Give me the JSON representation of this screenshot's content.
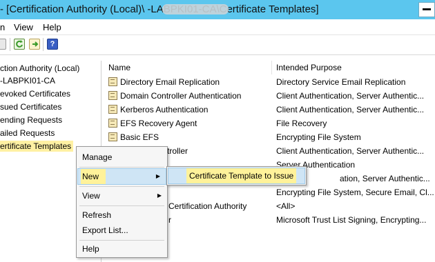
{
  "window": {
    "title": "- [Certification Authority (Local)\\                    -LABPKI01-CA\\Certificate Templates]"
  },
  "menubar": {
    "items": [
      "View",
      "Help"
    ]
  },
  "toolbar": {
    "icons": [
      "back-icon",
      "refresh-icon",
      "export-list-icon",
      "help-icon"
    ]
  },
  "tree": {
    "items": [
      {
        "label": "ction Authority (Local)"
      },
      {
        "label": "       -LABPKI01-CA"
      },
      {
        "label": "evoked Certificates"
      },
      {
        "label": "sued Certificates"
      },
      {
        "label": "ending Requests"
      },
      {
        "label": "ailed Requests"
      },
      {
        "label": "ertificate Templates"
      }
    ]
  },
  "list": {
    "columns": [
      "Name",
      "Intended Purpose"
    ],
    "rows": [
      {
        "name": "Directory Email Replication",
        "purpose": "Directory Service Email Replication"
      },
      {
        "name": "Domain Controller Authentication",
        "purpose": "Client Authentication, Server Authentic..."
      },
      {
        "name": "Kerberos Authentication",
        "purpose": "Client Authentication, Server Authentic..."
      },
      {
        "name": "EFS Recovery Agent",
        "purpose": "File Recovery"
      },
      {
        "name": "Basic EFS",
        "purpose": "Encrypting File System"
      },
      {
        "name": "troller",
        "purpose": "Client Authentication, Server Authentic..."
      },
      {
        "name": "",
        "purpose": "Server Authentication"
      },
      {
        "name": "",
        "purpose": "ation, Server Authentic..."
      },
      {
        "name": "",
        "purpose": "Encrypting File System, Secure Email, Cl..."
      },
      {
        "name": "Certification Authority",
        "purpose": "<All>"
      },
      {
        "name": "r",
        "purpose": "Microsoft Trust List Signing, Encrypting..."
      }
    ]
  },
  "context_menu": {
    "items": {
      "manage": "Manage",
      "new": "New",
      "view": "View",
      "refresh": "Refresh",
      "export": "Export List...",
      "help": "Help"
    },
    "arrow": "▶"
  },
  "submenu": {
    "item": "Certificate Template to Issue"
  },
  "colors": {
    "titlebar": "#5bc6ee",
    "highlight": "#fff29a",
    "hover": "#cfe5f5"
  }
}
